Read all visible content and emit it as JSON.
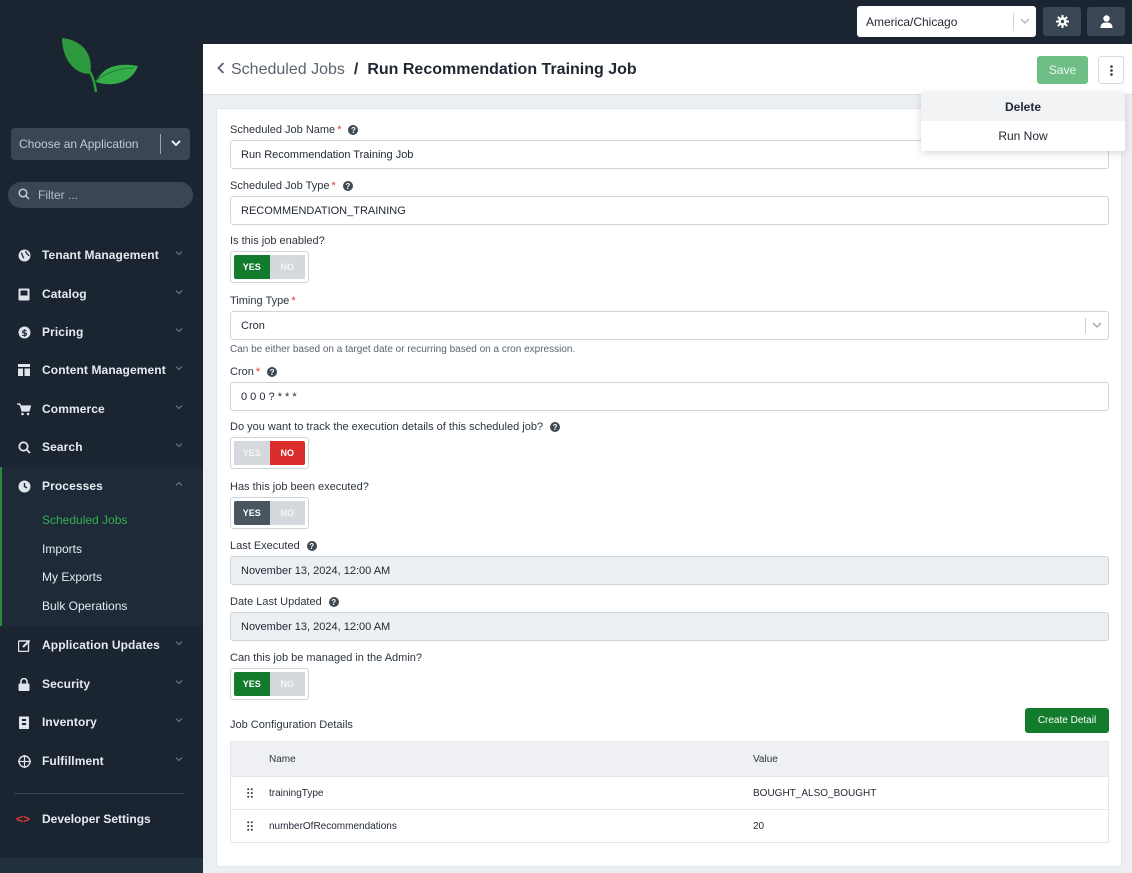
{
  "sidebar": {
    "app_select_placeholder": "Choose an Application",
    "filter_placeholder": "Filter ...",
    "nav": [
      {
        "label": "Tenant Management",
        "icon": "globe-icon"
      },
      {
        "label": "Catalog",
        "icon": "book-icon"
      },
      {
        "label": "Pricing",
        "icon": "dollar-icon"
      },
      {
        "label": "Content Management",
        "icon": "layout-icon"
      },
      {
        "label": "Commerce",
        "icon": "cart-icon"
      },
      {
        "label": "Search",
        "icon": "search-icon"
      },
      {
        "label": "Processes",
        "icon": "clock-icon"
      },
      {
        "label": "Application Updates",
        "icon": "edit-icon"
      },
      {
        "label": "Security",
        "icon": "lock-icon"
      },
      {
        "label": "Inventory",
        "icon": "warehouse-icon"
      },
      {
        "label": "Fulfillment",
        "icon": "crosshair-icon"
      }
    ],
    "processes_sub": [
      "Scheduled Jobs",
      "Imports",
      "My Exports",
      "Bulk Operations"
    ],
    "developer_settings": "Developer Settings",
    "developer_icon": "<>",
    "accent_color": "#34b04c"
  },
  "topbar": {
    "timezone": "America/Chicago"
  },
  "header": {
    "breadcrumb_parent": "Scheduled Jobs",
    "breadcrumb_sep": "/",
    "title": "Run Recommendation Training Job",
    "save_label": "Save"
  },
  "menu": {
    "items": [
      "Delete",
      "Run Now"
    ]
  },
  "form": {
    "name_label": "Scheduled Job Name",
    "name_value": "Run Recommendation Training Job",
    "type_label": "Scheduled Job Type",
    "type_value": "RECOMMENDATION_TRAINING",
    "enabled_label": "Is this job enabled?",
    "timing_label": "Timing Type",
    "timing_value": "Cron",
    "timing_hint": "Can be either based on a target date or recurring based on a cron expression.",
    "cron_label": "Cron",
    "cron_value": "0 0 0 ? * * *",
    "track_label": "Do you want to track the execution details of this scheduled job?",
    "executed_label": "Has this job been executed?",
    "last_executed_label": "Last Executed",
    "last_executed_value": "November 13, 2024, 12:00 AM",
    "last_updated_label": "Date Last Updated",
    "last_updated_value": "November 13, 2024, 12:00 AM",
    "admin_label": "Can this job be managed in the Admin?",
    "required_mark": "*",
    "yes": "YES",
    "no": "NO",
    "toggles": {
      "enabled": "YES",
      "track": "NO",
      "executed": "YES",
      "admin": "YES"
    }
  },
  "config": {
    "title": "Job Configuration Details",
    "create_label": "Create Detail",
    "col_name": "Name",
    "col_value": "Value",
    "rows": [
      {
        "name": "trainingType",
        "value": "BOUGHT_ALSO_BOUGHT"
      },
      {
        "name": "numberOfRecommendations",
        "value": "20"
      }
    ]
  }
}
